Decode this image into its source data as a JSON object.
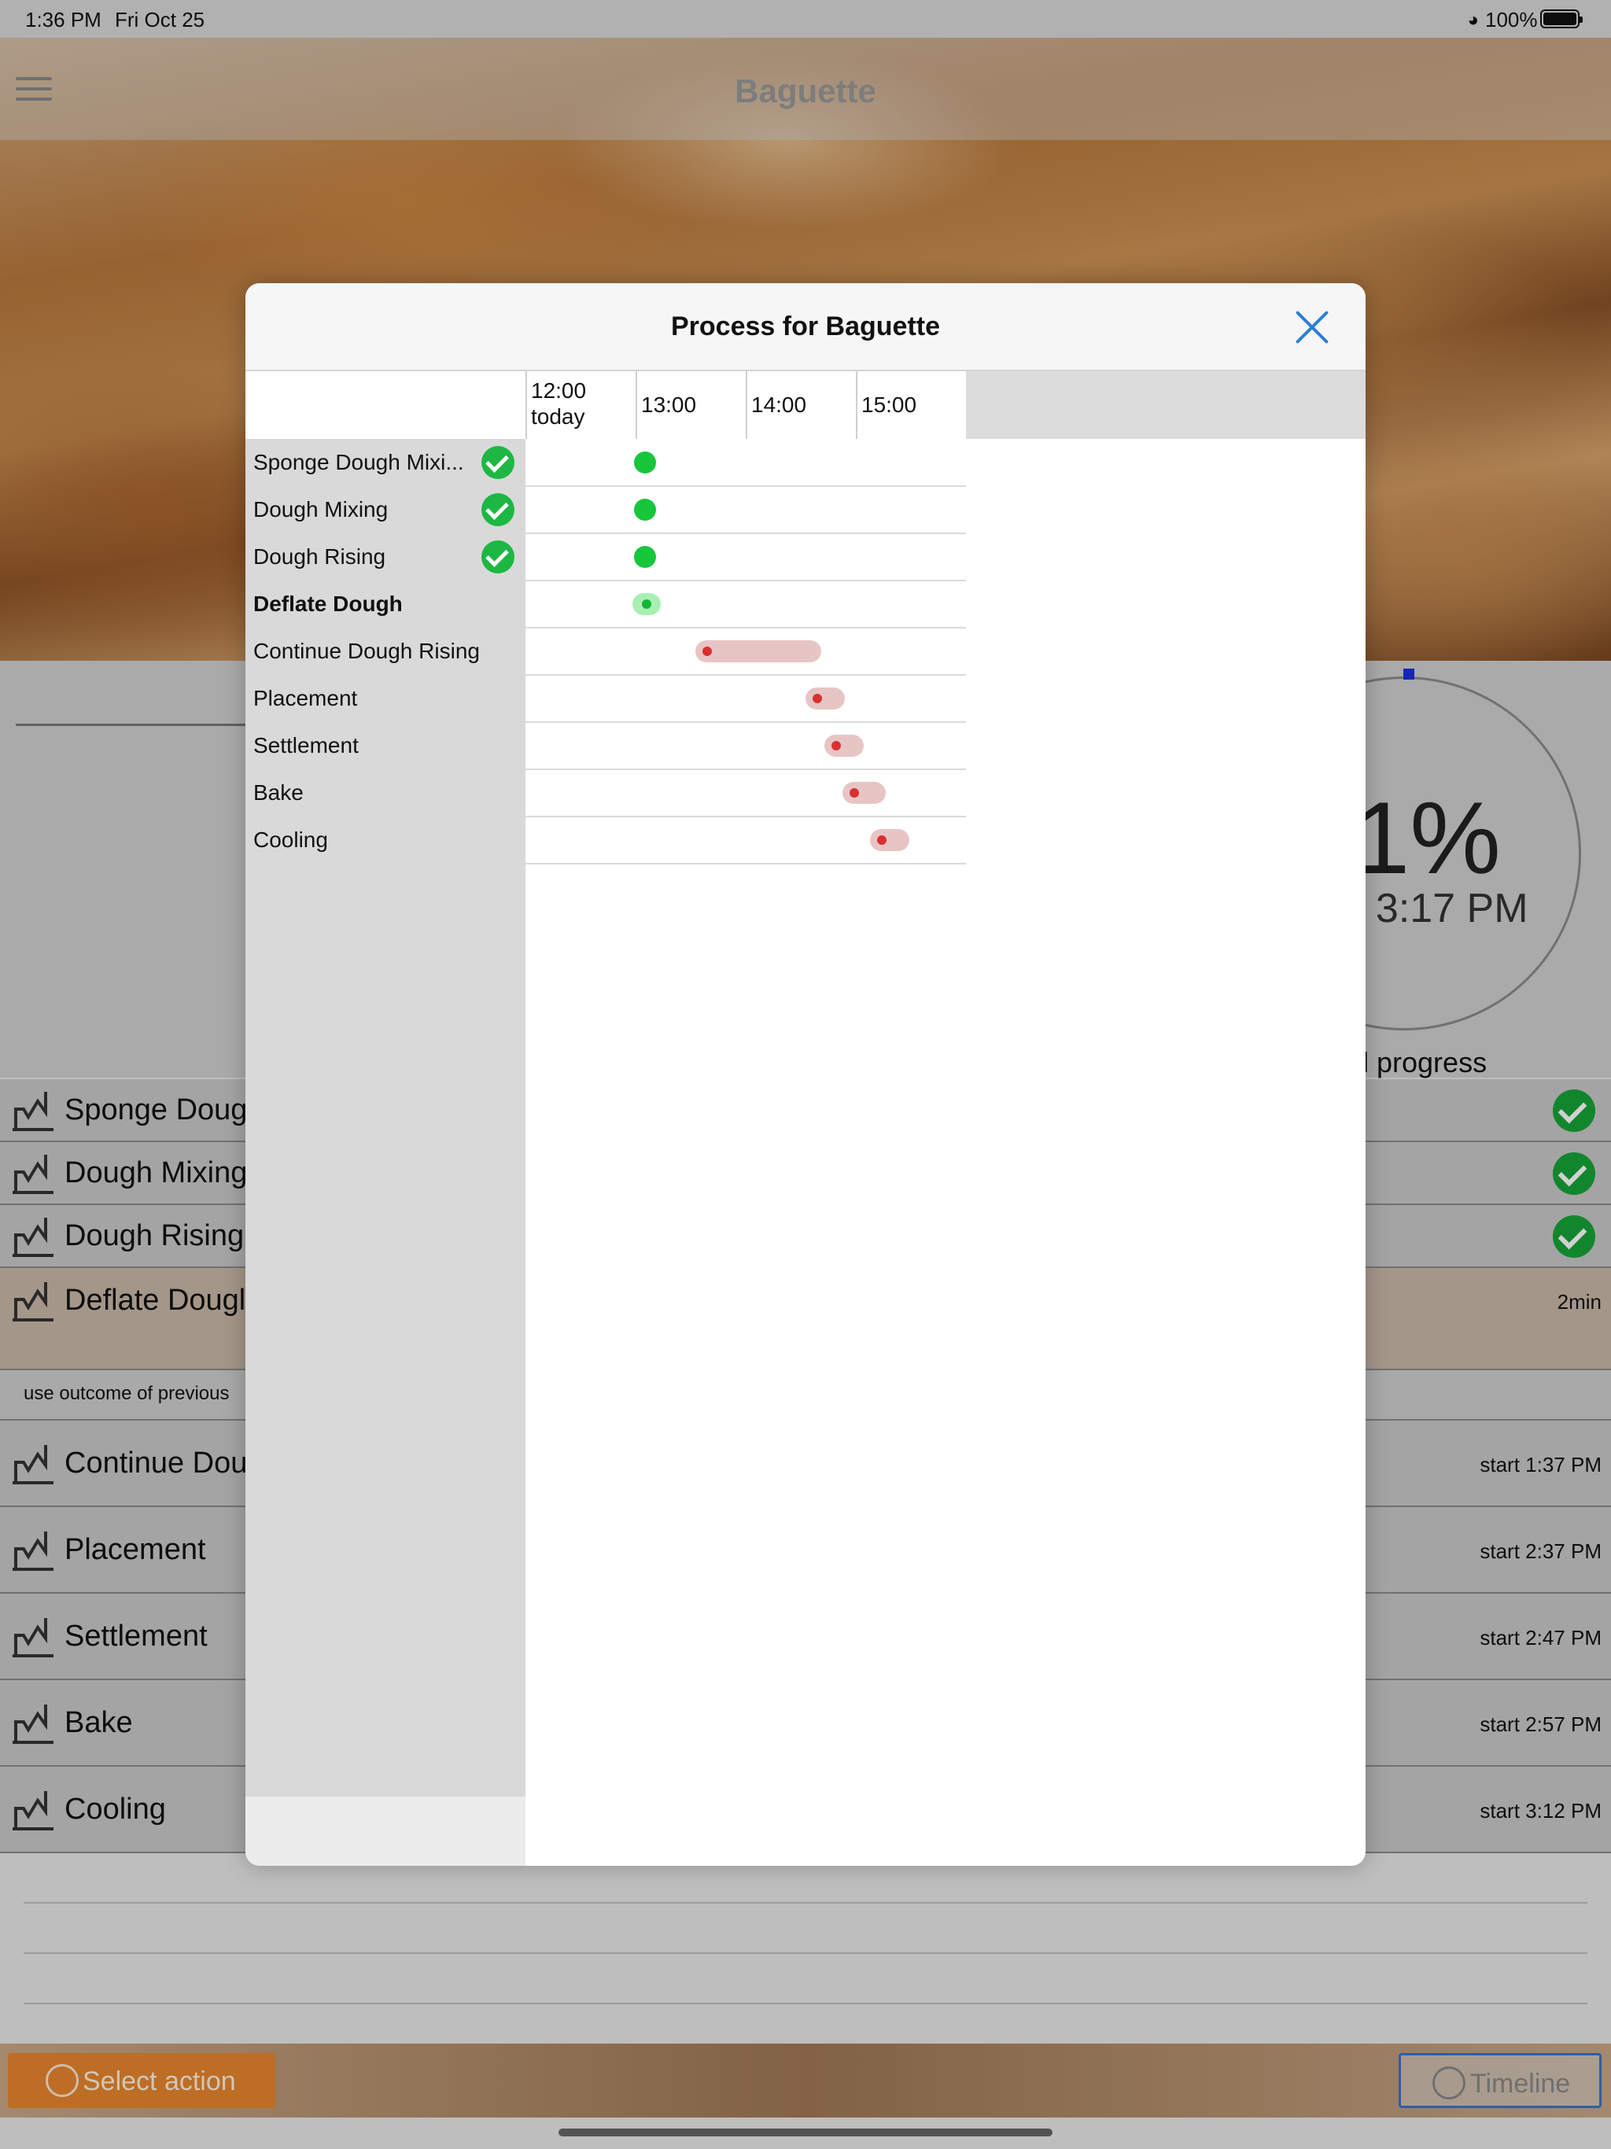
{
  "status_bar": {
    "time": "1:36 PM",
    "date": "Fri Oct 25",
    "battery": "100%"
  },
  "nav": {
    "title": "Baguette"
  },
  "progress": {
    "percent_partial": "1%",
    "end_partial": ": 3:17 PM",
    "label_partial": "l progress"
  },
  "steps": [
    {
      "name": "Sponge Doug",
      "status": "done",
      "icon": "mixer-icon"
    },
    {
      "name": "Dough Mixing",
      "status": "done",
      "icon": "mixer-icon"
    },
    {
      "name": "Dough Rising",
      "status": "done",
      "icon": "cloud-icon"
    },
    {
      "name": "Deflate Dougl",
      "status": "active",
      "icon": "mixer-icon",
      "right": "2min"
    },
    {
      "name": "Continue Dou",
      "status": "pending",
      "icon": "cloud-icon",
      "right": "start 1:37 PM"
    },
    {
      "name": "Placement",
      "status": "pending",
      "icon": "placement-icon",
      "right": "start 2:37 PM"
    },
    {
      "name": "Settlement",
      "status": "pending",
      "icon": "oven-icon",
      "right": "start 2:47 PM"
    },
    {
      "name": "Bake",
      "status": "pending",
      "icon": "oven-icon",
      "right": "start 2:57 PM"
    },
    {
      "name": "Cooling",
      "status": "pending",
      "icon": "steam-icon",
      "right": "start 3:12 PM"
    }
  ],
  "note": "use outcome of previous",
  "bottom_bar": {
    "select_action": "Select action",
    "timeline": "Timeline"
  },
  "modal": {
    "title": "Process for Baguette",
    "time_headers": [
      {
        "line1": "12:00",
        "line2": "today"
      },
      {
        "line1": "13:00",
        "line2": ""
      },
      {
        "line1": "14:00",
        "line2": ""
      },
      {
        "line1": "15:00",
        "line2": ""
      }
    ],
    "rows": [
      {
        "label": "Sponge Dough Mixi...",
        "state": "done",
        "start": "13:00",
        "end": "13:00"
      },
      {
        "label": "Dough Mixing",
        "state": "done",
        "start": "13:00",
        "end": "13:00"
      },
      {
        "label": "Dough Rising",
        "state": "done",
        "start": "13:00",
        "end": "13:00"
      },
      {
        "label": "Deflate Dough",
        "state": "current",
        "start": "13:00",
        "end": "13:00"
      },
      {
        "label": "Continue Dough Rising",
        "state": "planned",
        "start": "13:37",
        "end": "14:37"
      },
      {
        "label": "Placement",
        "state": "planned",
        "start": "14:37",
        "end": "14:47"
      },
      {
        "label": "Settlement",
        "state": "planned",
        "start": "14:47",
        "end": "14:57"
      },
      {
        "label": "Bake",
        "state": "planned",
        "start": "14:57",
        "end": "15:12"
      },
      {
        "label": "Cooling",
        "state": "planned",
        "start": "15:12",
        "end": "15:17"
      }
    ]
  },
  "colors": {
    "accent_blue": "#2b7fd4",
    "done_green": "#17c63a",
    "planned_bar": "#e8c5c5",
    "planned_dot": "#d93030",
    "action_orange": "#e8852c"
  }
}
